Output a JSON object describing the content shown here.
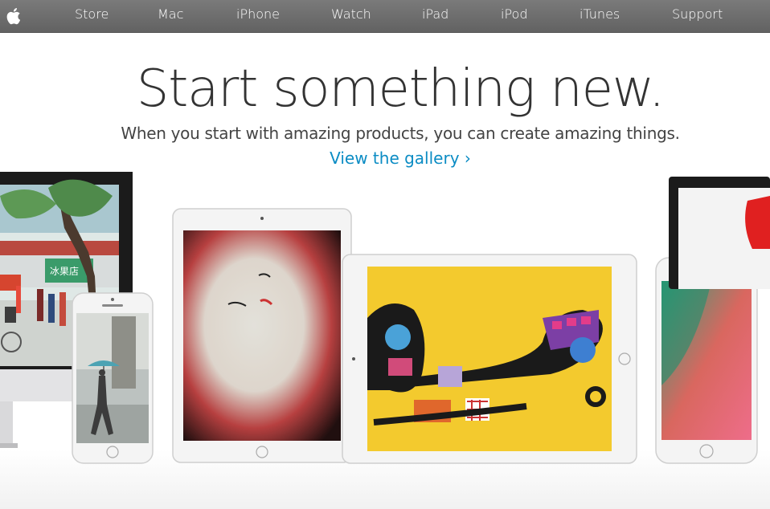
{
  "nav": {
    "logo_icon": "apple-logo-icon",
    "items": [
      "Store",
      "Mac",
      "iPhone",
      "Watch",
      "iPad",
      "iPod",
      "iTunes",
      "Support"
    ]
  },
  "hero": {
    "headline": "Start something new.",
    "subhead": "When you start with amazing products, you can create amazing things.",
    "link": "View the gallery ›"
  },
  "colors": {
    "nav_bg": "#6f6f6f",
    "link": "#0b8cc4",
    "ipad_air_screen": "#f3ca2e"
  }
}
